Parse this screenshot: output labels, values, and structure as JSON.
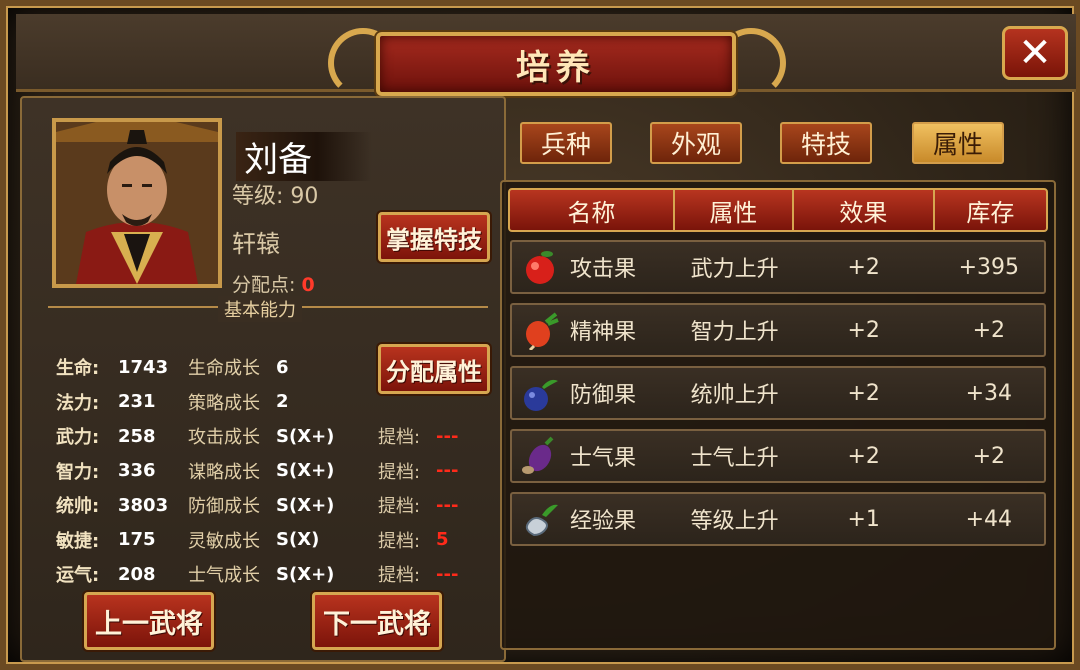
{
  "window": {
    "title": "培养",
    "close_label": "✕"
  },
  "hero": {
    "name": "刘备",
    "level_label": "等级:",
    "level_value": "90",
    "faction": "轩辕",
    "alloc_label": "分配点:",
    "alloc_value": "0"
  },
  "buttons": {
    "master_skill": "掌握特技",
    "assign_attr": "分配属性",
    "prev_general": "上一武将",
    "next_general": "下一武将"
  },
  "section_label": "基本能力",
  "stats": [
    {
      "k": "生命:",
      "v": "1743",
      "gk": "生命成长",
      "gv": "6",
      "tk": "",
      "tv": ""
    },
    {
      "k": "法力:",
      "v": "231",
      "gk": "策略成长",
      "gv": "2",
      "tk": "",
      "tv": ""
    },
    {
      "k": "武力:",
      "v": "258",
      "gk": "攻击成长",
      "gv": "S(X+)",
      "tk": "提档:",
      "tv": "---"
    },
    {
      "k": "智力:",
      "v": "336",
      "gk": "谋略成长",
      "gv": "S(X+)",
      "tk": "提档:",
      "tv": "---"
    },
    {
      "k": "统帅:",
      "v": "3803",
      "gk": "防御成长",
      "gv": "S(X+)",
      "tk": "提档:",
      "tv": "---"
    },
    {
      "k": "敏捷:",
      "v": "175",
      "gk": "灵敏成长",
      "gv": "S(X)",
      "tk": "提档:",
      "tv": "5"
    },
    {
      "k": "运气:",
      "v": "208",
      "gk": "士气成长",
      "gv": "S(X+)",
      "tk": "提档:",
      "tv": "---"
    }
  ],
  "tabs": [
    {
      "label": "兵种",
      "active": false
    },
    {
      "label": "外观",
      "active": false
    },
    {
      "label": "特技",
      "active": false
    },
    {
      "label": "属性",
      "active": true
    }
  ],
  "table": {
    "headers": [
      "名称",
      "属性",
      "效果",
      "库存"
    ],
    "rows": [
      {
        "icon": "apple-icon",
        "color": "#d8201a",
        "name": "攻击果",
        "attr": "武力上升",
        "effect": "+2",
        "stock": "+395"
      },
      {
        "icon": "radish-icon",
        "color": "#e0401e",
        "name": "精神果",
        "attr": "智力上升",
        "effect": "+2",
        "stock": "+2"
      },
      {
        "icon": "blueberry-icon",
        "color": "#2a3a9a",
        "name": "防御果",
        "attr": "统帅上升",
        "effect": "+2",
        "stock": "+34"
      },
      {
        "icon": "eggplant-icon",
        "color": "#6a2a8a",
        "name": "士气果",
        "attr": "士气上升",
        "effect": "+2",
        "stock": "+2"
      },
      {
        "icon": "gourd-icon",
        "color": "#c8d0d8",
        "name": "经验果",
        "attr": "等级上升",
        "effect": "+1",
        "stock": "+44"
      }
    ]
  }
}
